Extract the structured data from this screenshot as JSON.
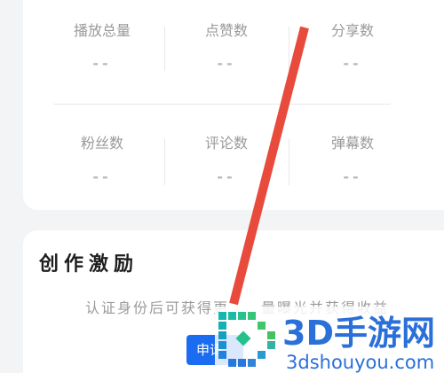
{
  "stats": {
    "rows": [
      [
        {
          "label": "播放总量",
          "value": "--"
        },
        {
          "label": "点赞数",
          "value": "--"
        },
        {
          "label": "分享数",
          "value": "--"
        }
      ],
      [
        {
          "label": "粉丝数",
          "value": "--"
        },
        {
          "label": "评论数",
          "value": "--"
        },
        {
          "label": "弹幕数",
          "value": "--"
        }
      ]
    ]
  },
  "incentive": {
    "title": "创作激励",
    "desc_part1": "认证身份后可获得更",
    "desc_part2": "量曝光并获得收益",
    "apply_button": "申请"
  },
  "watermark": {
    "brand": "3D手游网",
    "site": "3dshouyou.com"
  },
  "icons": {
    "watermark_logo": "pixel-d-logo-icon",
    "annotation": "red-arrow-annotation"
  },
  "colors": {
    "page_bg": "#f3f4f6",
    "card_bg": "#ffffff",
    "label_text": "#9a9a9a",
    "value_text": "#b9b9b9",
    "divider": "#e8e8e8",
    "title_text": "#1f1f1f",
    "button_bg": "#1a6cf0",
    "annotation": "#e84a3b",
    "watermark_text": "#2b6fd8"
  }
}
